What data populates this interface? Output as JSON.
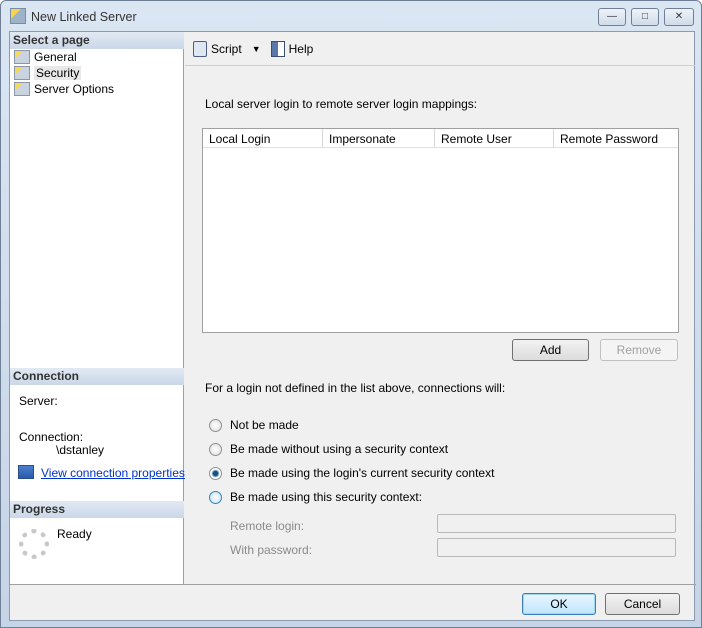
{
  "window": {
    "title": "New Linked Server",
    "min": "—",
    "max": "□",
    "close": "✕"
  },
  "sidebar": {
    "header": "Select a page",
    "items": [
      {
        "label": "General"
      },
      {
        "label": "Security"
      },
      {
        "label": "Server Options"
      }
    ]
  },
  "connection": {
    "header": "Connection",
    "server_label": "Server:",
    "connection_label": "Connection:",
    "connection_value": "\\dstanley",
    "link": "View connection properties"
  },
  "progress": {
    "header": "Progress",
    "status": "Ready"
  },
  "toolbar": {
    "script": "Script",
    "help": "Help"
  },
  "main": {
    "mappings_label": "Local server login to remote server login mappings:",
    "columns": [
      "Local Login",
      "Impersonate",
      "Remote User",
      "Remote Password"
    ],
    "add": "Add",
    "remove": "Remove",
    "fallback_label": "For a login not defined in the list above, connections will:",
    "options": [
      "Not be made",
      "Be made without using a security context",
      "Be made using the login's current security context",
      "Be made using this security context:"
    ],
    "selected_option": 2,
    "remote_login_label": "Remote login:",
    "password_label": "With password:"
  },
  "footer": {
    "ok": "OK",
    "cancel": "Cancel"
  }
}
